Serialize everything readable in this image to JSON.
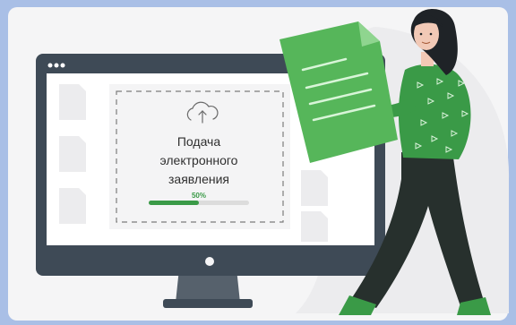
{
  "upload_card": {
    "title_lines": [
      "Подача",
      "электронного",
      "заявления"
    ],
    "progress_label": "50%",
    "progress": 0.5
  },
  "icons": {
    "upload": "cloud-upload-icon",
    "window_dots": "window-controls-icon",
    "document": "document-icon"
  },
  "colors": {
    "background": "#a9bfe6",
    "panel": "#f5f5f6",
    "monitor_frame": "#3e4a56",
    "accent_green": "#3a9a47",
    "document_green": "#56b65a",
    "pants": "#27302d"
  }
}
